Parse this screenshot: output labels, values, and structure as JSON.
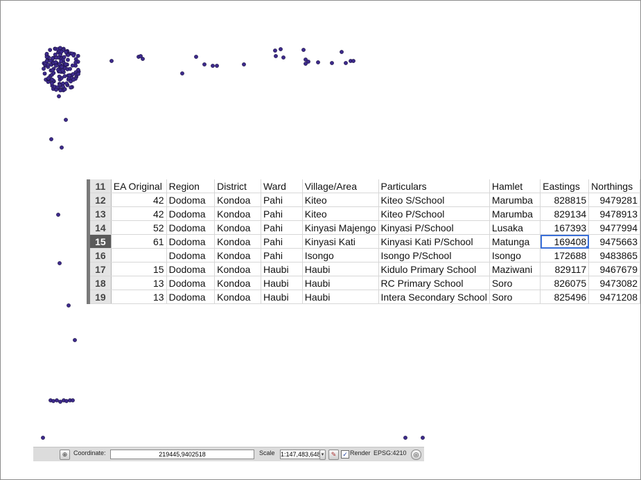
{
  "spreadsheet": {
    "rows": [
      {
        "row": "11",
        "cells": [
          "EA Original",
          "Region",
          "District",
          "Ward",
          "Village/Area",
          "Particulars",
          "Hamlet",
          "Eastings",
          "Northings"
        ]
      },
      {
        "row": "12",
        "cells": [
          "42",
          "Dodoma",
          "Kondoa",
          "Pahi",
          "Kiteo",
          "Kiteo S/School",
          "Marumba",
          "828815",
          "9479281"
        ]
      },
      {
        "row": "13",
        "cells": [
          "42",
          "Dodoma",
          "Kondoa",
          "Pahi",
          "Kiteo",
          "Kiteo P/School",
          "Marumba",
          "829134",
          "9478913"
        ]
      },
      {
        "row": "14",
        "cells": [
          "52",
          "Dodoma",
          "Kondoa",
          "Pahi",
          "Kinyasi Majengo",
          "Kinyasi P/School",
          "Lusaka",
          "167393",
          "9477994"
        ]
      },
      {
        "row": "15",
        "cells": [
          "61",
          "Dodoma",
          "Kondoa",
          "Pahi",
          "Kinyasi Kati",
          "Kinyasi Kati P/School",
          "Matunga",
          "169408",
          "9475663"
        ]
      },
      {
        "row": "16",
        "cells": [
          "",
          "Dodoma",
          "Kondoa",
          "Pahi",
          "Isongo",
          "Isongo P/School",
          "Isongo",
          "172688",
          "9483865"
        ]
      },
      {
        "row": "17",
        "cells": [
          "15",
          "Dodoma",
          "Kondoa",
          "Haubi",
          "Haubi",
          "Kidulo Primary School",
          "Maziwani",
          "829117",
          "9467679"
        ]
      },
      {
        "row": "18",
        "cells": [
          "13",
          "Dodoma",
          "Kondoa",
          "Haubi",
          "Haubi",
          "RC Primary School",
          "Soro",
          "826075",
          "9473082"
        ]
      },
      {
        "row": "19",
        "cells": [
          "13",
          "Dodoma",
          "Kondoa",
          "Haubi",
          "Haubi",
          "Intera Secondary School",
          "Soro",
          "825496",
          "9471208"
        ]
      }
    ],
    "selected_row": "15",
    "active_cell": {
      "row": "15",
      "column": "Eastings"
    }
  },
  "statusbar": {
    "toggle_icon": "coordinate-toggle-icon",
    "coordinate_label": "Coordinate:",
    "coordinate_value": "219445,9402518",
    "scale_label": "Scale",
    "scale_value": "1:147,483,648",
    "render_label": "Render",
    "render_checked": true,
    "crs_label": "EPSG:4210",
    "crs_icon": "projection-icon",
    "stop_render_icon": "stop-render-icon"
  },
  "map": {
    "point_color": "#3d2a8c",
    "layer": "point layer"
  }
}
